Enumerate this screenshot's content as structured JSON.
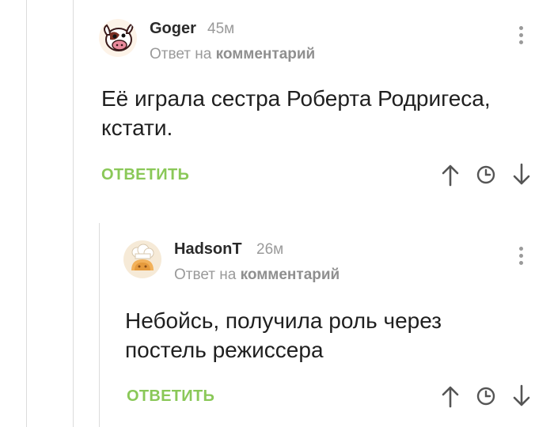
{
  "comments": [
    {
      "author": "Goger",
      "time": "45м",
      "reply_prefix": "Ответ на",
      "reply_target": "комментарий",
      "text_lines": [
        "Её играла сестра Роберта Родригеса,",
        "кстати."
      ],
      "reply_label": "ОТВЕТИТЬ",
      "avatar_icon": "cartoon-cow-avatar"
    },
    {
      "author": "HadsonT",
      "time": "26м",
      "reply_prefix": "Ответ на",
      "reply_target": "комментарий",
      "text_lines": [
        "Небойсь, получила роль через",
        "постель режиссера"
      ],
      "reply_label": "ОТВЕТИТЬ",
      "avatar_icon": "pastry-chef-avatar"
    }
  ],
  "icons": {
    "menu": "kebab-menu-icon",
    "upvote": "arrow-up-icon",
    "save": "clock-icon",
    "downvote": "arrow-down-icon"
  },
  "colors": {
    "accent_green": "#8ac858",
    "meta_gray": "#9a9a9a",
    "thread_line": "#dcdcdc",
    "icon_gray": "#555555"
  }
}
